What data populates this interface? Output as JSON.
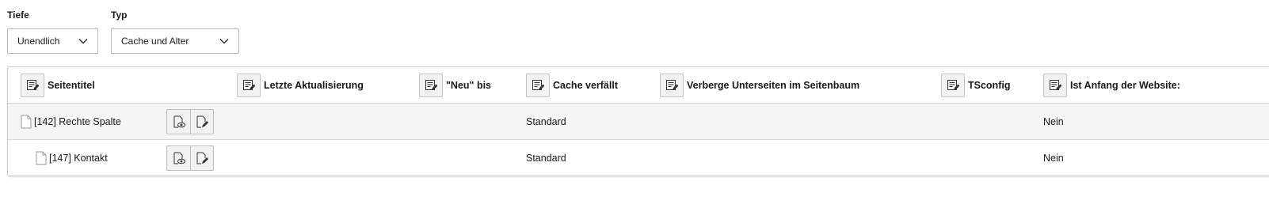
{
  "filters": {
    "depth": {
      "label": "Tiefe",
      "value": "Unendlich"
    },
    "type": {
      "label": "Typ",
      "value": "Cache und Alter"
    }
  },
  "table": {
    "columns": [
      {
        "label": "Seitentitel",
        "icon": "edit-columns-icon"
      },
      {
        "label": "Letzte Aktualisierung",
        "icon": "edit-columns-icon"
      },
      {
        "label": "\"Neu\" bis",
        "icon": "edit-columns-icon"
      },
      {
        "label": "Cache verfällt",
        "icon": "edit-columns-icon"
      },
      {
        "label": "Verberge Unterseiten im Seitenbaum",
        "icon": "edit-columns-icon"
      },
      {
        "label": "TSconfig",
        "icon": "edit-columns-icon"
      },
      {
        "label": "Ist Anfang der Website:",
        "icon": "edit-columns-icon"
      }
    ],
    "rows": [
      {
        "title": "[142] Rechte Spalte",
        "last_update": "",
        "new_until": "",
        "cache_expires": "Standard",
        "hide_subpages": "",
        "tsconfig": "",
        "is_site_root": "Nein"
      },
      {
        "title": "[147] Kontakt",
        "last_update": "",
        "new_until": "",
        "cache_expires": "Standard",
        "hide_subpages": "",
        "tsconfig": "",
        "is_site_root": "Nein"
      }
    ],
    "row_actions": [
      "view-page-icon",
      "edit-page-icon"
    ]
  }
}
